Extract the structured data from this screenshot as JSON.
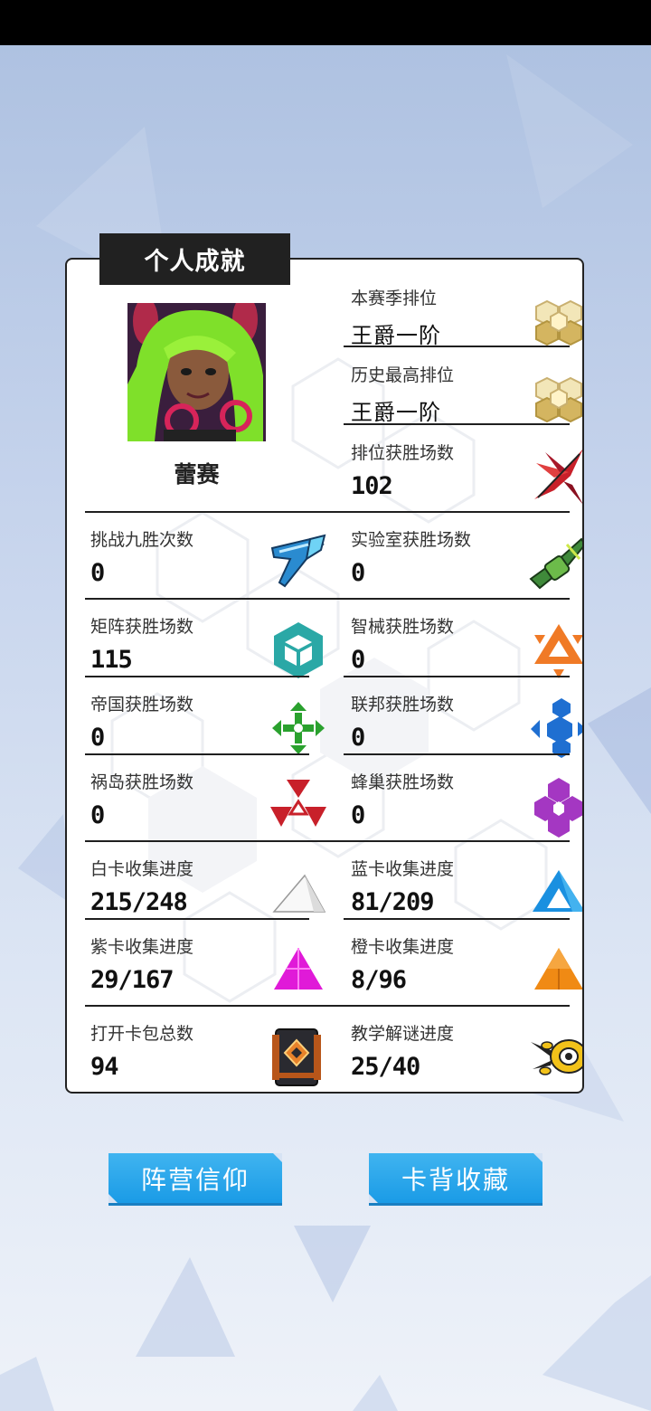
{
  "title": "个人成就",
  "player": {
    "name": "蕾赛",
    "avatar": "green-haired-girl-avatar"
  },
  "rank": [
    {
      "label": "本赛季排位",
      "value": "王爵一阶",
      "icon": "gold-hexagon-badge-icon"
    },
    {
      "label": "历史最高排位",
      "value": "王爵一阶",
      "icon": "gold-hexagon-badge-icon"
    },
    {
      "label": "排位获胜场数",
      "value": "102",
      "icon": "red-winged-ship-icon"
    }
  ],
  "stats": [
    {
      "label": "挑战九胜次数",
      "value": "0",
      "icon": "blue-blaster-icon"
    },
    {
      "label": "实验室获胜场数",
      "value": "0",
      "icon": "green-cannon-icon"
    },
    {
      "label": "矩阵获胜场数",
      "value": "115",
      "icon": "teal-cube-icon"
    },
    {
      "label": "智械获胜场数",
      "value": "0",
      "icon": "orange-triangle-icon"
    },
    {
      "label": "帝国获胜场数",
      "value": "0",
      "icon": "green-cross-icon"
    },
    {
      "label": "联邦获胜场数",
      "value": "0",
      "icon": "blue-hexagons-icon"
    },
    {
      "label": "祸岛获胜场数",
      "value": "0",
      "icon": "red-triangles-icon"
    },
    {
      "label": "蜂巢获胜场数",
      "value": "0",
      "icon": "purple-hive-icon"
    },
    {
      "label": "白卡收集进度",
      "value": "215/248",
      "icon": "white-triangle-icon"
    },
    {
      "label": "蓝卡收集进度",
      "value": "81/209",
      "icon": "blue-triangle-icon"
    },
    {
      "label": "紫卡收集进度",
      "value": "29/167",
      "icon": "magenta-triangle-icon"
    },
    {
      "label": "橙卡收集进度",
      "value": "8/96",
      "icon": "orange-card-triangle-icon"
    },
    {
      "label": "打开卡包总数",
      "value": "94",
      "icon": "card-pack-icon"
    },
    {
      "label": "教学解谜进度",
      "value": "25/40",
      "icon": "yellow-robot-icon"
    }
  ],
  "buttons": {
    "faith": "阵营信仰",
    "card_back": "卡背收藏"
  },
  "colors": {
    "button": "#1a9be6",
    "gold": "#d9c27a",
    "panel_border": "#222222"
  }
}
